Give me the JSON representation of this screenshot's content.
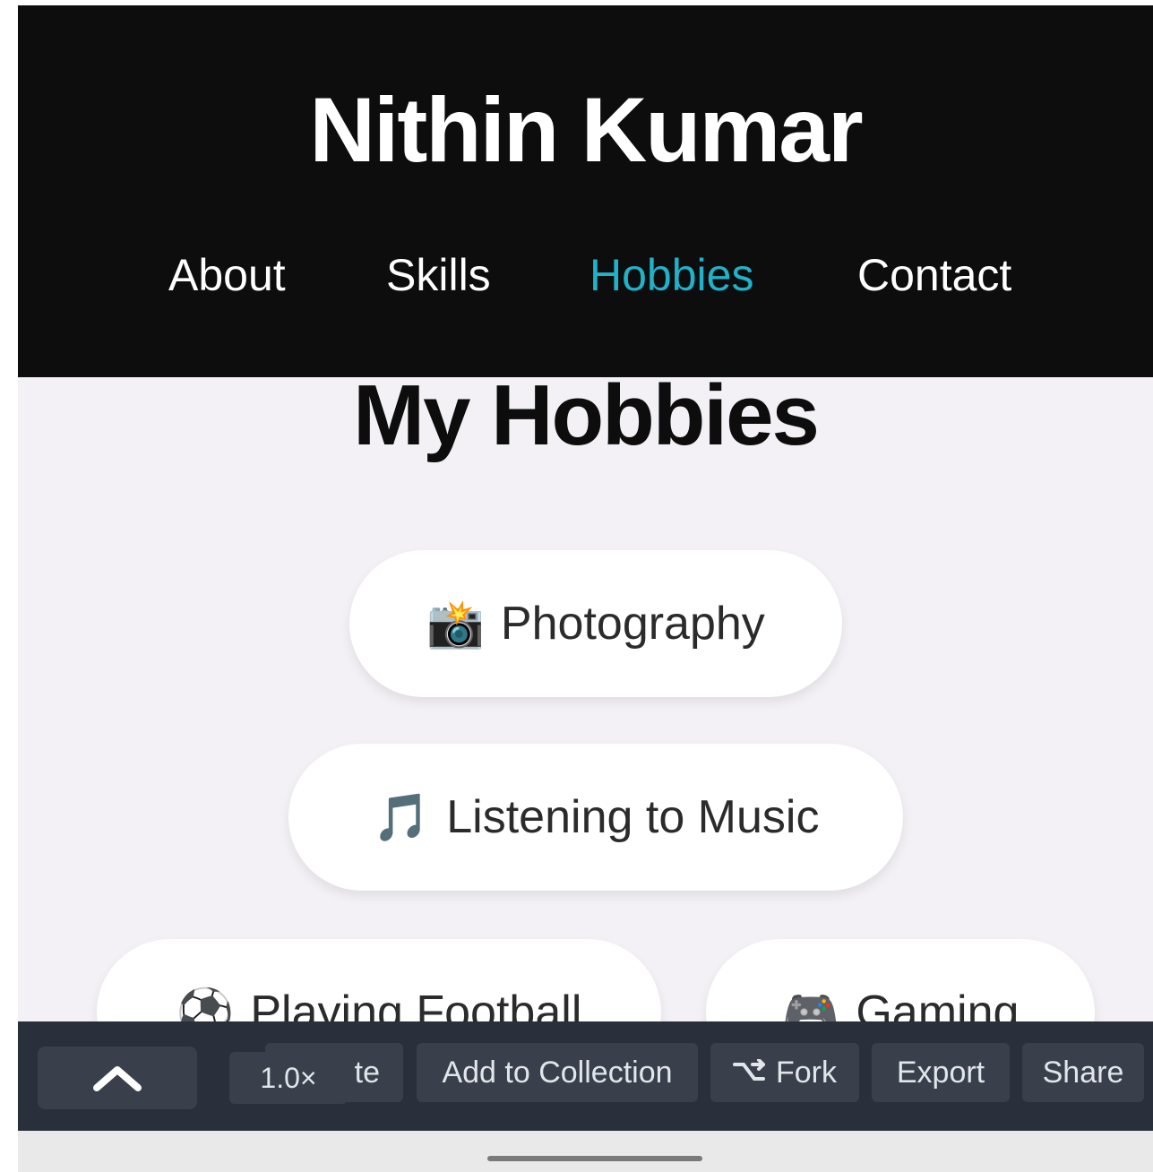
{
  "header": {
    "title": "Nithin Kumar",
    "nav": [
      {
        "label": "About",
        "active": false
      },
      {
        "label": "Skills",
        "active": false
      },
      {
        "label": "Hobbies",
        "active": true
      },
      {
        "label": "Contact",
        "active": false
      }
    ]
  },
  "main": {
    "section_title": "My Hobbies",
    "hobbies": [
      {
        "emoji": "📸",
        "label": "Photography"
      },
      {
        "emoji": "🎵",
        "label": "Listening to Music"
      },
      {
        "emoji": "⚽",
        "label": "Playing Football"
      },
      {
        "emoji": "🎮",
        "label": "Gaming"
      }
    ]
  },
  "toolbar": {
    "zoom": "1.0×",
    "partial_label": "te",
    "add_to_collection": "Add to Collection",
    "fork": "Fork",
    "export": "Export",
    "share": "Share"
  },
  "colors": {
    "header_bg": "#0d0d0d",
    "nav_active": "#1fb2c8",
    "page_bg": "#f3f1f5",
    "toolbar_bg": "#2a303b",
    "toolbar_button_bg": "#3a404b"
  },
  "icons": {
    "scroll_up": "chevron-up-icon",
    "fork": "fork-icon"
  }
}
